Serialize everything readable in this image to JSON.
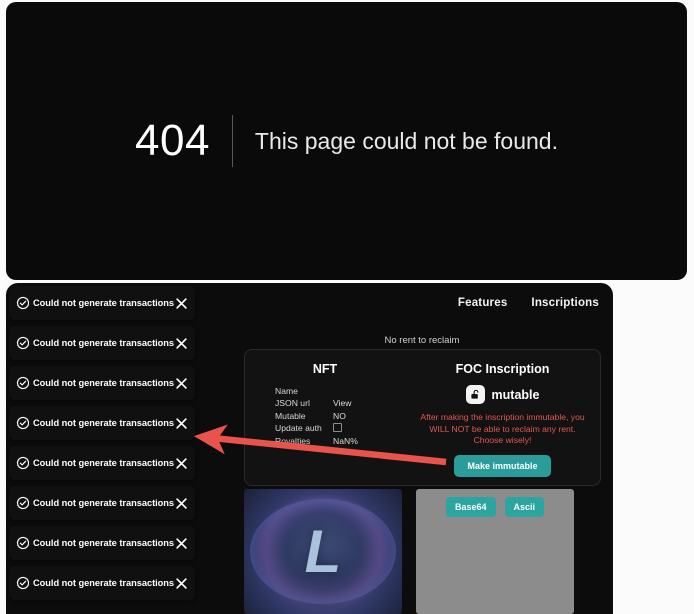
{
  "notfound": {
    "code": "404",
    "message": "This page could not be found."
  },
  "app": {
    "nav": [
      {
        "label": "Features",
        "name": "nav-link-features"
      },
      {
        "label": "Inscriptions",
        "name": "nav-link-inscriptions"
      }
    ],
    "rent_note": "No rent to reclaim",
    "nft_panel": {
      "title": "NFT",
      "rows": [
        {
          "key": "Name",
          "value": ""
        },
        {
          "key": "JSON url",
          "value": "View"
        },
        {
          "key": "Mutable",
          "value": "NO"
        },
        {
          "key": "Update auth",
          "value": ""
        },
        {
          "key": "Royalties",
          "value": "NaN%"
        }
      ]
    },
    "foc_panel": {
      "title": "FOC Inscription",
      "state_label": "mutable",
      "state_icon": "unlocked-padlock-icon",
      "warning": "After making the inscription immutable, you WILL NOT be able to reclaim any rent. Choose wisely!",
      "action_button": "Make immutable"
    },
    "media": {
      "image_letter": "L",
      "image_alt": "nft-artwork",
      "chips": [
        {
          "label": "Base64",
          "name": "chip-base64"
        },
        {
          "label": "Ascii",
          "name": "chip-ascii"
        }
      ]
    }
  },
  "toasts": {
    "message": "Could not generate transactions",
    "icon": "check-circle-icon",
    "close_icon": "close-icon",
    "count": 8,
    "items": [
      "Could not generate transactions",
      "Could not generate transactions",
      "Could not generate transactions",
      "Could not generate transactions",
      "Could not generate transactions",
      "Could not generate transactions",
      "Could not generate transactions",
      "Could not generate transactions"
    ]
  },
  "annotation": {
    "type": "arrow",
    "color": "#e8544b",
    "points_from": "Make immutable",
    "points_to": "toast-stack"
  },
  "colors": {
    "panel_bg": "#0a0a0a",
    "accent_teal": "#2a9d9b",
    "warning_red": "#e0584f",
    "annotation_red": "#e8544b"
  }
}
